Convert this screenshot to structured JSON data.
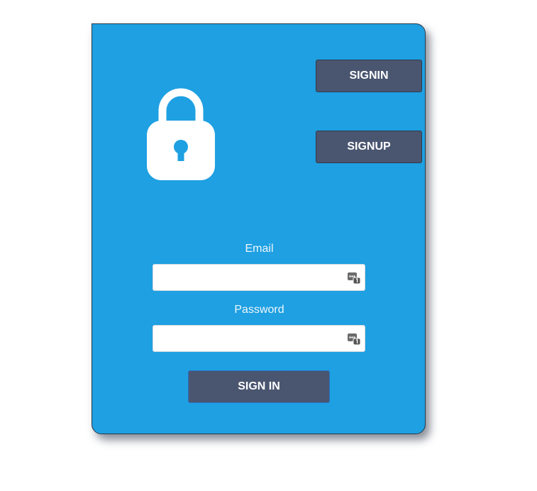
{
  "tabs": {
    "signin_label": "SIGNIN",
    "signup_label": "SIGNUP"
  },
  "form": {
    "email_label": "Email",
    "email_value": "",
    "password_label": "Password",
    "password_value": "",
    "submit_label": "SIGN IN"
  },
  "icons": {
    "hero": "lock-icon",
    "field_autofill": "password-manager-icon"
  },
  "colors": {
    "card_background": "#1ea0e2",
    "button_background": "#4a5670",
    "lock_color": "#ffffff"
  }
}
